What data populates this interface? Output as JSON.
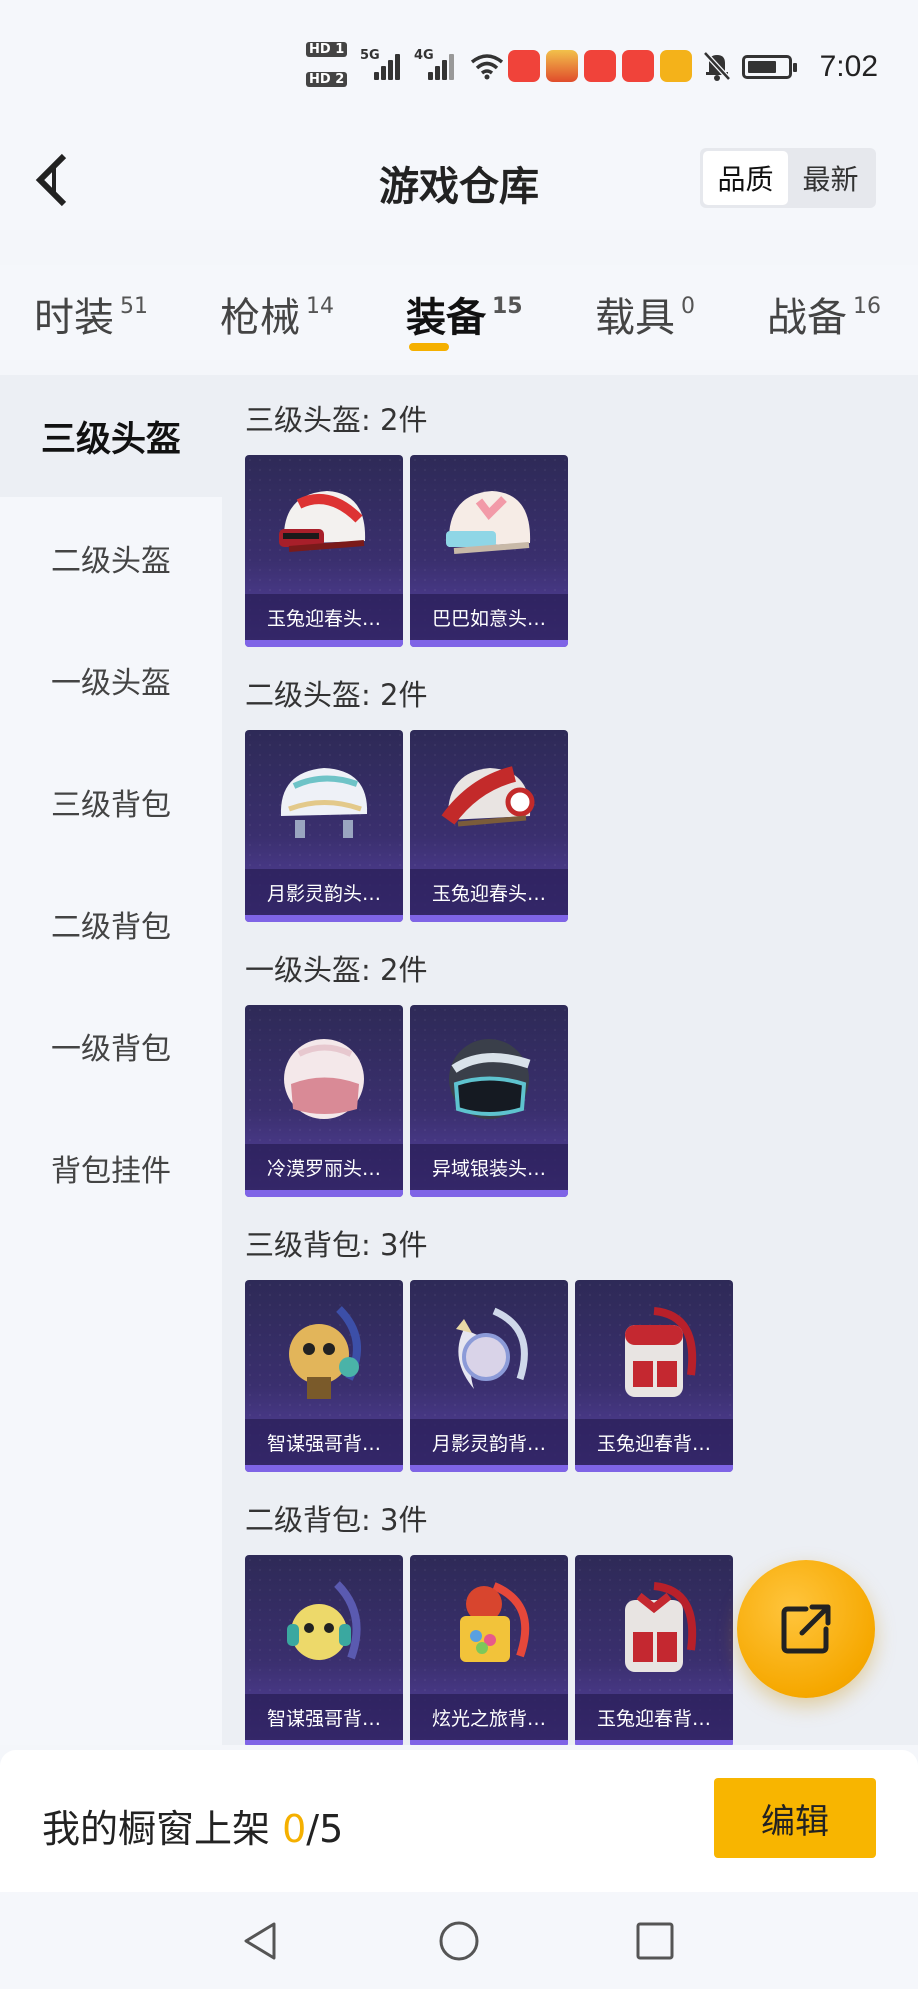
{
  "status_bar": {
    "hd1": "HD 1",
    "hd2": "HD 2",
    "net1": "5G",
    "net2": "4G",
    "time": "7:02"
  },
  "header": {
    "title": "游戏仓库",
    "sort_options": [
      "品质",
      "最新"
    ],
    "sort_selected": "品质"
  },
  "tabs": [
    {
      "label": "时装",
      "count": "51"
    },
    {
      "label": "枪械",
      "count": "14"
    },
    {
      "label": "装备",
      "count": "15"
    },
    {
      "label": "载具",
      "count": "0"
    },
    {
      "label": "战备",
      "count": "16"
    }
  ],
  "active_tab": "装备",
  "sidebar": {
    "items": [
      "三级头盔",
      "二级头盔",
      "一级头盔",
      "三级背包",
      "二级背包",
      "一级背包",
      "背包挂件"
    ],
    "active": "三级头盔"
  },
  "sections": [
    {
      "title": "三级头盔: 2件",
      "items": [
        "玉兔迎春头…",
        "巴巴如意头…"
      ]
    },
    {
      "title": "二级头盔: 2件",
      "items": [
        "月影灵韵头…",
        "玉兔迎春头…"
      ]
    },
    {
      "title": "一级头盔: 2件",
      "items": [
        "冷漠罗丽头…",
        "异域银装头…"
      ]
    },
    {
      "title": "三级背包: 3件",
      "items": [
        "智谋强哥背…",
        "月影灵韵背…",
        "玉兔迎春背…"
      ]
    },
    {
      "title": "二级背包: 3件",
      "items": [
        "智谋强哥背…",
        "炫光之旅背…",
        "玉兔迎春背…"
      ]
    }
  ],
  "bottom": {
    "showcase_label": "我的橱窗上架",
    "showcase_count": "0",
    "showcase_total": "/5",
    "edit_label": "编辑"
  },
  "colors": {
    "accent": "#f8b500",
    "card_bg": "#3a2f6e",
    "card_bar": "#7f64e6"
  }
}
